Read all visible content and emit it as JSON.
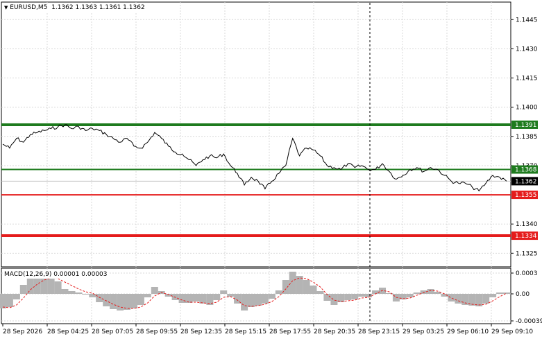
{
  "header": {
    "symbol": "EURUSD,M5",
    "ohlc": "1.1362 1.1363 1.1361 1.1362",
    "menu_arrow": "triangle-down-icon"
  },
  "price_axis": {
    "ticks": [
      "1.1445",
      "1.1430",
      "1.1415",
      "1.1400",
      "1.1385",
      "1.1370",
      "1.1340",
      "1.1325"
    ],
    "range": [
      1.1318,
      1.1454
    ]
  },
  "macd": {
    "title": "MACD(12,26,9) 0.00001 0.00003",
    "ticks": [
      "0.0003",
      "0.00",
      "-0.00039"
    ],
    "range": [
      -0.00043,
      0.00037
    ]
  },
  "time_axis": {
    "labels": [
      "28 Sep 2026",
      "28 Sep 04:25",
      "28 Sep 07:05",
      "28 Sep 09:55",
      "28 Sep 12:35",
      "28 Sep 15:15",
      "28 Sep 17:55",
      "28 Sep 20:35",
      "28 Sep 23:15",
      "29 Sep 03:25",
      "29 Sep 06:10",
      "29 Sep 09:10"
    ]
  },
  "levels": [
    {
      "price": 1.1391,
      "label": "1.1391",
      "color": "#1e7b1e",
      "type": "resistance"
    },
    {
      "price": 1.1368,
      "label": "1.1368",
      "color": "#1e7b1e",
      "type": "resistance"
    },
    {
      "price": 1.1355,
      "label": "1.1355",
      "color": "#e51c1c",
      "type": "support"
    },
    {
      "price": 1.1334,
      "label": "1.1334",
      "color": "#e51c1c",
      "type": "support"
    }
  ],
  "current_price": {
    "label": "1.1362",
    "price": 1.1362,
    "color": "#000000"
  },
  "colors": {
    "grid": "#d8d8d8",
    "price_line": "#000000",
    "macd_hist": "#b4b4b4",
    "macd_signal": "#e51c1c",
    "crosshair": "#000000"
  },
  "chart_data": {
    "type": "line",
    "title": "EURUSD,M5",
    "x": [
      0,
      10,
      20,
      30,
      40,
      50,
      60,
      70,
      80,
      90,
      100,
      110,
      120,
      130,
      140,
      150,
      160,
      170,
      180,
      190,
      200,
      210,
      220,
      230,
      240,
      250,
      260,
      270,
      280,
      290,
      300,
      310,
      320,
      330,
      340,
      350,
      360,
      370,
      380,
      390,
      400,
      410,
      420,
      430,
      440,
      450,
      460,
      470,
      480,
      490,
      500,
      510,
      520,
      530,
      540,
      550,
      560,
      570,
      580,
      590,
      600,
      610,
      620,
      630,
      640,
      650,
      660,
      670,
      680,
      690,
      700,
      710,
      720,
      730
    ],
    "series": [
      {
        "values": [
          1.1381,
          1.1379,
          1.1384,
          1.1382,
          1.1386,
          1.1387,
          1.1388,
          1.1389,
          1.139,
          1.1391,
          1.1389,
          1.139,
          1.1388,
          1.1389,
          1.1388,
          1.1386,
          1.1384,
          1.1382,
          1.1384,
          1.138,
          1.1379,
          1.1382,
          1.1387,
          1.1384,
          1.138,
          1.1377,
          1.1376,
          1.1373,
          1.137,
          1.1373,
          1.1375,
          1.1374,
          1.1376,
          1.137,
          1.1366,
          1.136,
          1.1364,
          1.1362,
          1.1358,
          1.1362,
          1.1366,
          1.137,
          1.1384,
          1.1375,
          1.1379,
          1.1378,
          1.1375,
          1.137,
          1.1369,
          1.1368,
          1.1371,
          1.1369,
          1.137,
          1.1368,
          1.1368,
          1.1371,
          1.1367,
          1.1363,
          1.1365,
          1.1368,
          1.1369,
          1.1367,
          1.1369,
          1.1368,
          1.1365,
          1.1362,
          1.1361,
          1.1361,
          1.1359,
          1.1357,
          1.1361,
          1.1365,
          1.1364,
          1.1362
        ],
        "color": "#000000"
      },
      {
        "values": [
          -0.00021,
          -0.00019,
          -8e-05,
          0.00013,
          0.00023,
          0.00024,
          0.00027,
          0.00026,
          0.00018,
          7e-05,
          4e-05,
          2e-05,
          -1e-05,
          -5e-05,
          -0.00012,
          -0.00018,
          -0.00022,
          -0.00024,
          -0.00023,
          -0.00021,
          -0.00016,
          -5e-05,
          0.0001,
          4e-05,
          -4e-05,
          -9e-05,
          -0.00013,
          -0.00013,
          -0.00011,
          -0.00014,
          -0.00016,
          -9e-05,
          5e-05,
          -4e-05,
          -0.00014,
          -0.00024,
          -0.00019,
          -0.00017,
          -0.00014,
          -7e-05,
          5e-05,
          0.0002,
          0.00032,
          0.00026,
          0.0002,
          0.00012,
          4e-05,
          -0.0001,
          -0.00016,
          -0.00012,
          -9e-05,
          -8e-05,
          -4e-05,
          -5e-05,
          5e-05,
          9e-05,
          1e-05,
          -0.00011,
          -8e-05,
          -5e-05,
          2e-05,
          5e-05,
          7e-05,
          3e-05,
          -4e-05,
          -0.00011,
          -0.00014,
          -0.00016,
          -0.00017,
          -0.00018,
          -0.00014,
          -5e-05,
          2e-05,
          2e-05
        ],
        "color": "#b4b4b4"
      },
      {
        "values": [
          -0.00019,
          -0.0002,
          -0.00016,
          -6e-05,
          6e-05,
          0.00014,
          0.0002,
          0.00023,
          0.00022,
          0.00017,
          0.00012,
          7e-05,
          3e-05,
          1e-05,
          -5e-05,
          -0.0001,
          -0.00015,
          -0.00019,
          -0.00021,
          -0.00021,
          -0.00019,
          -0.00013,
          -3e-05,
          2e-05,
          -1e-05,
          -5e-05,
          -9e-05,
          -0.00012,
          -0.00012,
          -0.00013,
          -0.00014,
          -0.00012,
          -5e-05,
          -4e-05,
          -9e-05,
          -0.00017,
          -0.00018,
          -0.00017,
          -0.00015,
          -0.00011,
          -4e-05,
          7e-05,
          0.00019,
          0.00023,
          0.00022,
          0.00017,
          0.0001,
          -1e-05,
          -9e-05,
          -0.00011,
          -0.0001,
          -9e-05,
          -6e-05,
          -5e-05,
          0.0,
          5e-05,
          3e-05,
          -5e-05,
          -7e-05,
          -6e-05,
          -2e-05,
          2e-05,
          5e-05,
          4e-05,
          0.0,
          -6e-05,
          -0.0001,
          -0.00013,
          -0.00015,
          -0.00016,
          -0.00015,
          -0.0001,
          -4e-05,
          1e-05
        ],
        "color": "#e51c1c"
      }
    ]
  }
}
